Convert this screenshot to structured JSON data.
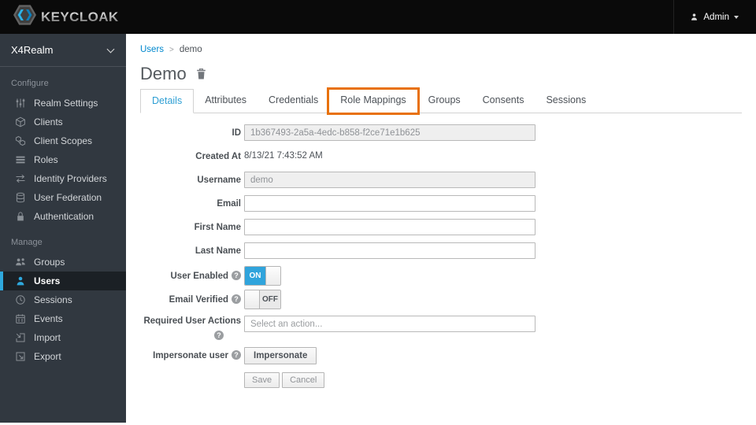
{
  "header": {
    "brand": {
      "logo_icon": "keycloak-logo-icon",
      "name": "KEYCLOAK"
    },
    "user_menu": {
      "icon": "user-icon",
      "label": "Admin",
      "caret_icon": "caret-down-icon"
    }
  },
  "sidebar": {
    "realm_selector": {
      "label": "X4Realm",
      "icon": "chevron-down-icon"
    },
    "sections": [
      {
        "label": "Configure",
        "items": [
          {
            "label": "Realm Settings",
            "icon": "sliders-icon"
          },
          {
            "label": "Clients",
            "icon": "cube-icon"
          },
          {
            "label": "Client Scopes",
            "icon": "cubes-icon"
          },
          {
            "label": "Roles",
            "icon": "list-icon"
          },
          {
            "label": "Identity Providers",
            "icon": "exchange-arrows-icon"
          },
          {
            "label": "User Federation",
            "icon": "database-icon"
          },
          {
            "label": "Authentication",
            "icon": "lock-icon"
          }
        ]
      },
      {
        "label": "Manage",
        "items": [
          {
            "label": "Groups",
            "icon": "group-icon"
          },
          {
            "label": "Users",
            "icon": "user-icon",
            "active": true
          },
          {
            "label": "Sessions",
            "icon": "clock-icon"
          },
          {
            "label": "Events",
            "icon": "calendar-icon"
          },
          {
            "label": "Import",
            "icon": "import-icon"
          },
          {
            "label": "Export",
            "icon": "export-icon"
          }
        ]
      }
    ]
  },
  "breadcrumb": {
    "separator": ">",
    "items": [
      {
        "label": "Users"
      },
      {
        "label": "demo"
      }
    ]
  },
  "page": {
    "title": "Demo",
    "delete_icon": "trash-icon"
  },
  "tabs": [
    {
      "label": "Details",
      "active": true
    },
    {
      "label": "Attributes"
    },
    {
      "label": "Credentials"
    },
    {
      "label": "Role Mappings",
      "highlighted": true,
      "highlight_color": "#e8710d"
    },
    {
      "label": "Groups"
    },
    {
      "label": "Consents"
    },
    {
      "label": "Sessions"
    }
  ],
  "form": {
    "id": {
      "label": "ID",
      "value": "1b367493-2a5a-4edc-b858-f2ce71e1b625",
      "disabled": true
    },
    "created_at": {
      "label": "Created At",
      "value": "8/13/21 7:43:52 AM"
    },
    "username": {
      "label": "Username",
      "value": "demo",
      "disabled": true
    },
    "email": {
      "label": "Email",
      "value": ""
    },
    "first_name": {
      "label": "First Name",
      "value": ""
    },
    "last_name": {
      "label": "Last Name",
      "value": ""
    },
    "user_enabled": {
      "label": "User Enabled",
      "state": "ON",
      "on_label": "ON"
    },
    "email_verified": {
      "label": "Email Verified",
      "state": "OFF",
      "off_label": "OFF"
    },
    "required_user_actions": {
      "label": "Required User Actions",
      "placeholder": "Select an action...",
      "value": ""
    },
    "impersonate_user": {
      "label": "Impersonate user",
      "button_label": "Impersonate"
    },
    "actions": {
      "save_label": "Save",
      "cancel_label": "Cancel"
    },
    "help_glyph": "?"
  },
  "colors": {
    "header_bg": "#0a0a0a",
    "sidebar_bg": "#313840",
    "accent_blue": "#2ea8dd",
    "link_blue": "#0088ce",
    "toggle_on_blue": "#30a4dc",
    "highlight_orange": "#e8710d"
  }
}
